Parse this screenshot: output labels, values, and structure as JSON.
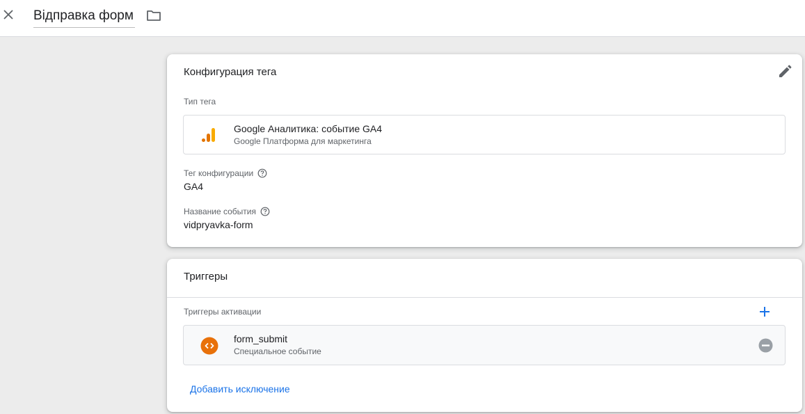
{
  "header": {
    "title": "Відправка форм"
  },
  "tag_config": {
    "card_title": "Конфигурация тега",
    "tag_type_label": "Тип тега",
    "tag_type": {
      "name": "Google Аналитика: событие GA4",
      "vendor": "Google Платформа для маркетинга"
    },
    "config_tag_label": "Тег конфигурации",
    "config_tag_value": "GA4",
    "event_name_label": "Название события",
    "event_name_value": "vidpryavka-form"
  },
  "triggers": {
    "card_title": "Триггеры",
    "firing_label": "Триггеры активации",
    "items": [
      {
        "name": "form_submit",
        "type": "Специальное событие"
      }
    ],
    "add_exception_label": "Добавить исключение"
  },
  "colors": {
    "accent_blue": "#1a73e8",
    "trigger_orange": "#e8710a",
    "ga_orange": "#f9ab00",
    "ga_dark_orange": "#e37400"
  },
  "icons": {
    "close": "close-icon",
    "folder": "folder-icon",
    "edit": "pencil-icon",
    "help": "help-circle-icon",
    "ga": "google-analytics-icon",
    "trigger": "custom-event-icon",
    "add": "plus-icon",
    "remove": "remove-circle-icon"
  }
}
